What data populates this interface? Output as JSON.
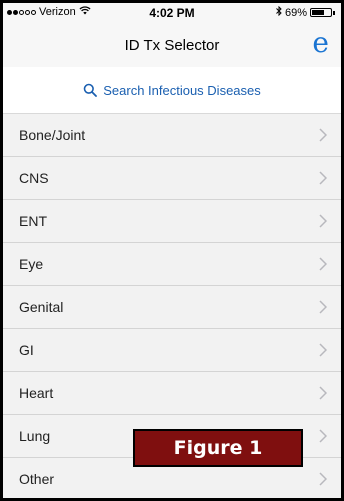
{
  "status_bar": {
    "carrier": "Verizon",
    "time": "4:02 PM",
    "battery_percent": "69%",
    "battery_level": 0.69,
    "signal_bars_filled": 2,
    "signal_bars_total": 5
  },
  "nav": {
    "title": "ID Tx Selector",
    "logo_letter": "e"
  },
  "search": {
    "label": "Search Infectious Diseases",
    "icon": "search-icon"
  },
  "list": {
    "items": [
      {
        "label": "Bone/Joint"
      },
      {
        "label": "CNS"
      },
      {
        "label": "ENT"
      },
      {
        "label": "Eye"
      },
      {
        "label": "Genital"
      },
      {
        "label": "GI"
      },
      {
        "label": "Heart"
      },
      {
        "label": "Lung"
      },
      {
        "label": "Other"
      }
    ]
  },
  "overlay": {
    "figure_label": "Figure 1"
  },
  "colors": {
    "accent_blue": "#1a74d2",
    "link_blue": "#1a5fb0",
    "figure_bg": "#7f0f0f"
  }
}
